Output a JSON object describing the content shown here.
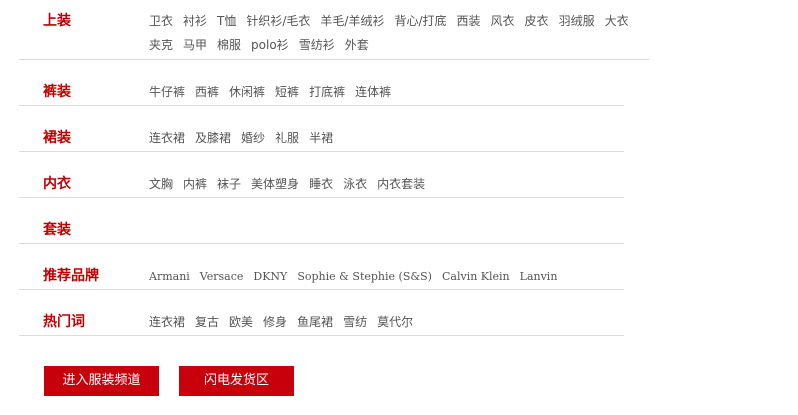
{
  "categories": [
    {
      "title": "上装",
      "items": [
        "卫衣",
        "衬衫",
        "T恤",
        "针织衫/毛衣",
        "羊毛/羊绒衫",
        "背心/打底",
        "西装",
        "风衣",
        "皮衣",
        "羽绒服",
        "大衣",
        "夹克",
        "马甲",
        "棉服",
        "polo衫",
        "雪纺衫",
        "外套"
      ]
    },
    {
      "title": "裤装",
      "items": [
        "牛仔裤",
        "西裤",
        "休闲裤",
        "短裤",
        "打底裤",
        "连体裤"
      ]
    },
    {
      "title": "裙装",
      "items": [
        "连衣裙",
        "及膝裙",
        "婚纱",
        "礼服",
        "半裙"
      ]
    },
    {
      "title": "内衣",
      "items": [
        "文胸",
        "内裤",
        "袜子",
        "美体塑身",
        "睡衣",
        "泳衣",
        "内衣套装"
      ]
    },
    {
      "title": "套装",
      "items": []
    },
    {
      "title": "推荐品牌",
      "items": [
        "Armani",
        "Versace",
        "DKNY",
        "Sophie & Stephie (S&S)",
        "Calvin Klein",
        "Lanvin"
      ]
    },
    {
      "title": "热门词",
      "items": [
        "连衣裙",
        "复古",
        "欧美",
        "修身",
        "鱼尾裙",
        "雪纺",
        "莫代尔"
      ]
    }
  ],
  "buttons": {
    "enter_channel": "进入服装频道",
    "flash_shipping": "闪电发货区"
  },
  "colors": {
    "accent": "#c00000",
    "button_bg": "#c8000b",
    "divider": "#dcdcdc",
    "item_text": "#555555"
  }
}
